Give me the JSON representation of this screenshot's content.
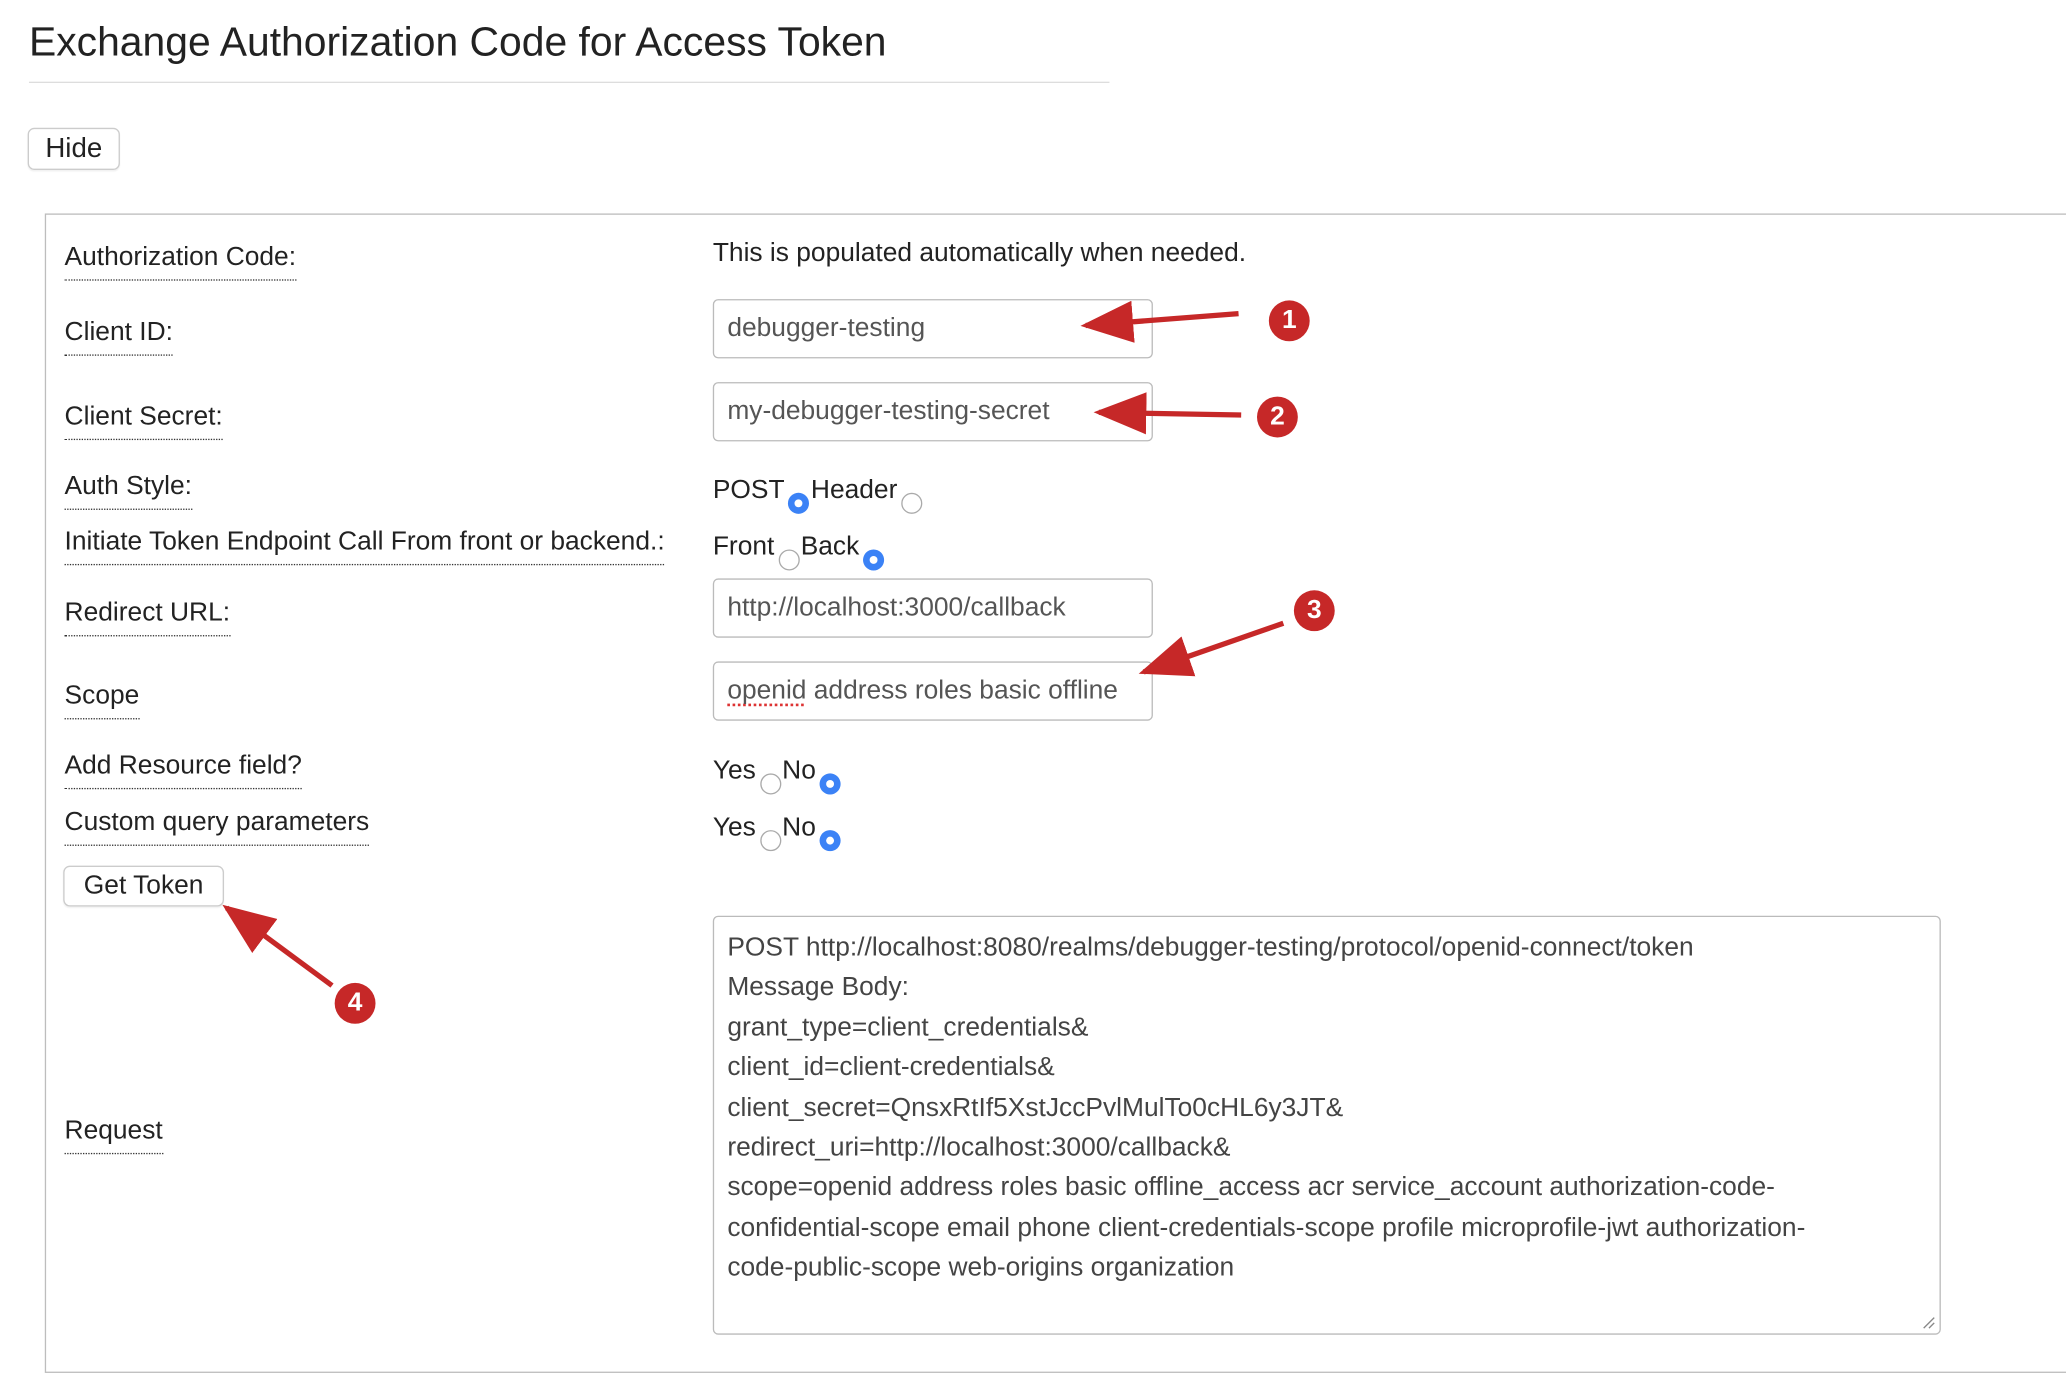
{
  "header": {
    "title": "Exchange Authorization Code for Access Token",
    "hide_label": "Hide"
  },
  "form": {
    "auth_code": {
      "label": "Authorization Code:",
      "value": "This is populated automatically when needed."
    },
    "client_id": {
      "label": "Client ID:",
      "value": "debugger-testing"
    },
    "client_secret": {
      "label": "Client Secret:",
      "value": "my-debugger-testing-secret"
    },
    "auth_style": {
      "label": "Auth Style:",
      "options": [
        "POST",
        "Header"
      ],
      "selected": "POST"
    },
    "initiate": {
      "label": "Initiate Token Endpoint Call From front or backend.:",
      "options": [
        "Front",
        "Back"
      ],
      "selected": "Back"
    },
    "redirect_url": {
      "label": "Redirect URL:",
      "value": "http://localhost:3000/callback"
    },
    "scope": {
      "label": "Scope",
      "value_first_word": "openid",
      "value_rest": " address roles basic offline"
    },
    "resource_field": {
      "label": "Add Resource field?",
      "options": [
        "Yes",
        "No"
      ],
      "selected": "No"
    },
    "custom_query": {
      "label": "Custom query parameters",
      "options": [
        "Yes",
        "No"
      ],
      "selected": "No"
    },
    "get_token_label": "Get Token",
    "request": {
      "label": "Request",
      "lines": [
        "POST http://localhost:8080/realms/debugger-testing/protocol/openid-connect/token",
        "Message Body:",
        "grant_type=client_credentials&",
        "client_id=client-credentials&",
        "client_secret=QnsxRtIf5XstJccPvlMulTo0cHL6y3JT&",
        "redirect_uri=http://localhost:3000/callback&",
        "scope=openid address roles basic offline_access acr service_account authorization-code-",
        "confidential-scope email phone client-credentials-scope profile microprofile-jwt authorization-",
        "code-public-scope web-origins organization"
      ]
    }
  },
  "annotations": {
    "badges": [
      "1",
      "2",
      "3",
      "4"
    ],
    "color": "#c62828"
  },
  "colors": {
    "radio_checked": "#3b82f6",
    "annotation_red": "#c62828"
  }
}
